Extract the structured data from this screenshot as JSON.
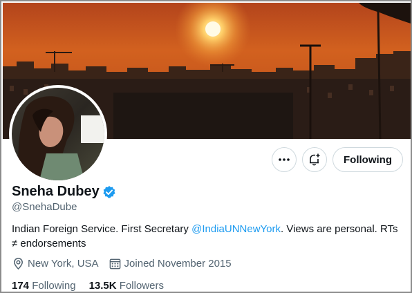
{
  "profile": {
    "display_name": "Sneha Dubey",
    "handle": "@SnehaDube",
    "verified": true,
    "bio_before": "Indian Foreign Service. First Secretary ",
    "bio_mention": "@IndiaUNNewYork",
    "bio_after": ". Views are personal. RTs ≠ endorsements",
    "location": "New York, USA",
    "joined": "Joined November 2015"
  },
  "actions": {
    "follow_label": "Following",
    "more_icon": "more-horizontal-icon",
    "notify_icon": "bell-plus-icon"
  },
  "stats": {
    "following_count": "174",
    "following_label": "Following",
    "followers_count": "13.5K",
    "followers_label": "Followers"
  },
  "colors": {
    "accent": "#1d9bf0",
    "secondary_text": "#536471",
    "primary_text": "#0f1419",
    "border": "#cfd9de"
  }
}
